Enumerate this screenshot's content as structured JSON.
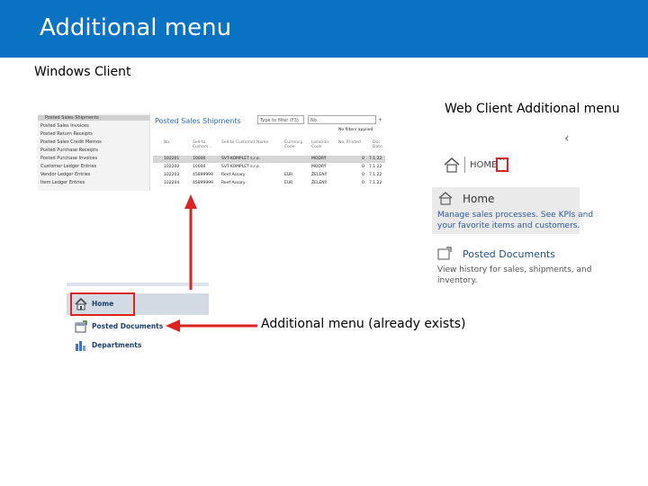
{
  "slide": {
    "title": "Additional menu",
    "windows_client_label": "Windows Client",
    "web_client_label": "Web Client Additional menu",
    "callout": "Additional menu (already exists)"
  },
  "windows_client": {
    "nav_items": [
      "Posted Sales Shipments",
      "Posted Sales Invoices",
      "Posted Return Receipts",
      "Posted Sales Credit Memos",
      "Posted Purchase Receipts",
      "Posted Purchase Invoices",
      "Customer Ledger Entries",
      "Vendor Ledger Entries",
      "Item Ledger Entries"
    ],
    "page_title": "Posted Sales Shipments",
    "search_placeholder": "Type to filter (F3)",
    "filter_field": "No.",
    "no_filters": "No filters applied",
    "columns": [
      "No.",
      "Sell-to Custom...",
      "Sell-to Customer Name",
      "Currency Code",
      "Location Code",
      "No. Printed",
      "Doc Date"
    ],
    "rows": [
      [
        "102201",
        "10000",
        "SVT-KOMPLET s.r.o.",
        "",
        "MODRÝ",
        "0",
        "7.1.22"
      ],
      [
        "102202",
        "10000",
        "SVT-KOMPLET s.r.o.",
        "",
        "MODRÝ",
        "0",
        "7.1.22"
      ],
      [
        "102203",
        "45899999",
        "Reef Assary",
        "EUR",
        "ŽELENÝ",
        "0",
        "7.1.22"
      ],
      [
        "102204",
        "45899999",
        "Reef Assary",
        "EUR",
        "ŽELENÝ",
        "0",
        "7.1.22"
      ]
    ]
  },
  "windows_nav": {
    "items": [
      "Home",
      "Posted Documents",
      "Departments"
    ]
  },
  "web_client": {
    "back_glyph": "‹",
    "breadcrumb": "HOME",
    "home_title": "Home",
    "home_desc_1": "Manage sales processes. See KPIs and",
    "home_desc_2": "your favorite items and customers.",
    "posted_title": "Posted Documents",
    "posted_desc_1": "View history for sales, shipments, and",
    "posted_desc_2": "inventory."
  },
  "colors": {
    "title_bar": "#0a72c2",
    "highlight": "#dd2222",
    "link_blue": "#2a6ebb"
  }
}
